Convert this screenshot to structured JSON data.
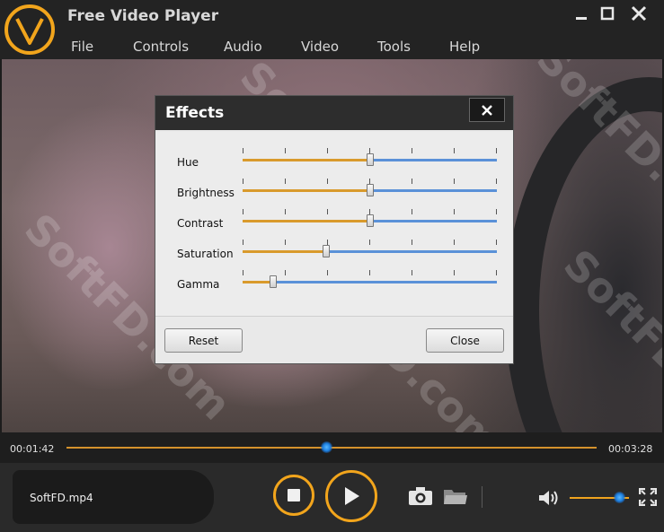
{
  "app": {
    "title": "Free Video Player"
  },
  "menu": [
    "File",
    "Controls",
    "Audio",
    "Video",
    "Tools",
    "Help"
  ],
  "window_buttons": [
    "minimize-icon",
    "maximize-icon",
    "close-icon"
  ],
  "watermark": "SoftFD.com",
  "effects_dialog": {
    "title": "Effects",
    "sliders": [
      {
        "label": "Hue",
        "value": 0.5
      },
      {
        "label": "Brightness",
        "value": 0.5
      },
      {
        "label": "Contrast",
        "value": 0.5
      },
      {
        "label": "Saturation",
        "value": 0.33
      },
      {
        "label": "Gamma",
        "value": 0.12
      }
    ],
    "reset_label": "Reset",
    "close_label": "Close"
  },
  "playback": {
    "current_time": "00:01:42",
    "total_time": "00:03:28",
    "progress": 0.49
  },
  "controls": {
    "file_name": "SoftFD.mp4",
    "volume": 0.82
  },
  "colors": {
    "accent": "#f2a51c",
    "track_blue": "#5a91d8",
    "track_orange": "#d99a2c"
  }
}
